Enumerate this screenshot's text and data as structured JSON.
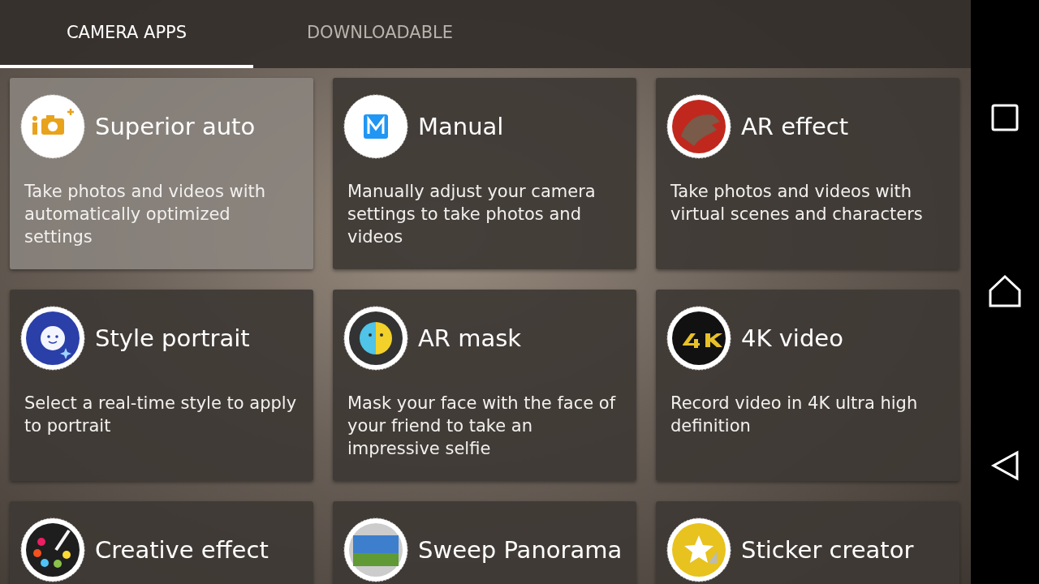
{
  "tabs": [
    {
      "label": "CAMERA APPS",
      "selected": true
    },
    {
      "label": "DOWNLOADABLE",
      "selected": false
    }
  ],
  "apps": [
    {
      "title": "Superior auto",
      "description": "Take photos and videos with automatically optimized settings",
      "selected": true
    },
    {
      "title": "Manual",
      "description": "Manually adjust your camera settings to take photos and videos",
      "selected": false
    },
    {
      "title": "AR effect",
      "description": "Take photos and videos with virtual scenes and characters",
      "selected": false
    },
    {
      "title": "Style portrait",
      "description": "Select a real-time style to apply to portrait",
      "selected": false
    },
    {
      "title": "AR mask",
      "description": "Mask your face with the face of your friend to take an impressive selfie",
      "selected": false
    },
    {
      "title": "4K video",
      "description": "Record video in 4K ultra high definition",
      "selected": false
    },
    {
      "title": "Creative effect",
      "selected": false
    },
    {
      "title": "Sweep Panorama",
      "selected": false
    },
    {
      "title": "Sticker creator",
      "selected": false
    }
  ]
}
